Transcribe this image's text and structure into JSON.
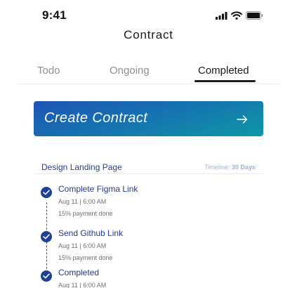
{
  "status_bar": {
    "time": "9:41"
  },
  "header": {
    "title": "Contract"
  },
  "tabs": [
    {
      "label": "Todo",
      "active": false
    },
    {
      "label": "Ongoing",
      "active": false
    },
    {
      "label": "Completed",
      "active": true
    }
  ],
  "cta": {
    "label": "Create Contract",
    "arrow": "→"
  },
  "section": {
    "title": "Design Landing Page",
    "timeline_label": "Timeline:",
    "timeline_value": "30 Days"
  },
  "steps": [
    {
      "title": "Complete Figma Link",
      "date": "Aug 11 | 6:00 AM",
      "payment": "15% payment done"
    },
    {
      "title": "Send Github Link",
      "date": "Aug 11 | 6:00 AM",
      "payment": "15% payment done"
    },
    {
      "title": "Completed",
      "date": "Aug 11 | 6:00 AM"
    }
  ],
  "colors": {
    "accent": "#1d3f9a",
    "cta_gradient_start": "#1e54b5",
    "cta_gradient_end": "#0f97a6",
    "muted_tab": "#8f8f8f",
    "timeline_text": "#9eb1d2"
  },
  "icons": [
    "cellular-signal-icon",
    "wifi-icon",
    "battery-icon",
    "arrow-right-icon",
    "check-circle-icon"
  ]
}
